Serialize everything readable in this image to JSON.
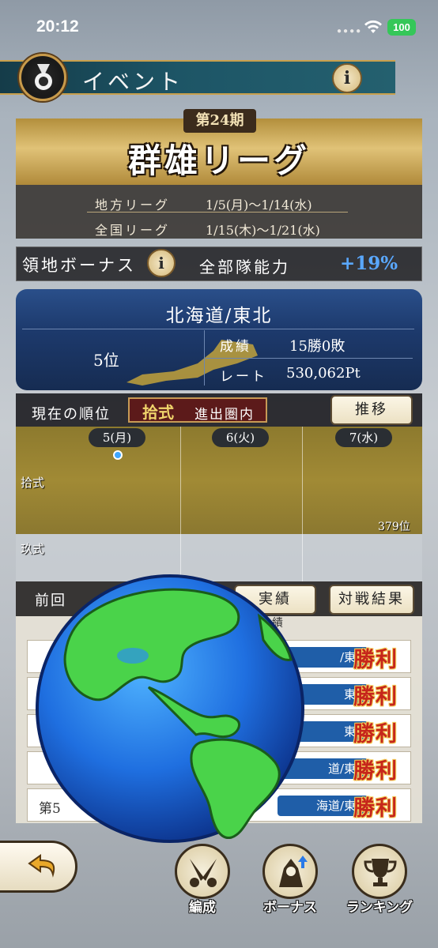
{
  "status": {
    "time": "20:12",
    "battery": "100"
  },
  "header": {
    "title": "イベント"
  },
  "season": {
    "tag": "第24期",
    "title": "群雄リーグ"
  },
  "schedule": [
    {
      "label": "地方リーグ",
      "dates": "1/5(月)〜1/14(水)"
    },
    {
      "label": "全国リーグ",
      "dates": "1/15(木)〜1/21(水)"
    }
  ],
  "bonus": {
    "label": "領地ボーナス",
    "name": "全部隊能力",
    "value": "+19%"
  },
  "region": {
    "name": "北海道/東北",
    "rank": "5位",
    "record_label": "成績",
    "record_value": "15勝0敗",
    "rate_label": "レート",
    "rate_value": "530,062Pt"
  },
  "standing": {
    "label": "現在の順位",
    "tier": "拾式",
    "note": "進出圏内",
    "history_button": "推移"
  },
  "chart_data": {
    "type": "line",
    "title": "",
    "categories": [
      "5(月)",
      "6(火)",
      "7(水)"
    ],
    "tiers": [
      "拾式",
      "玖式"
    ],
    "points": [
      {
        "x": "5(月)",
        "tier": "拾式"
      }
    ],
    "annotation": "379位"
  },
  "results": {
    "title": "前回",
    "partial_label": "績",
    "buttons": {
      "record": "実績",
      "battle": "対戦結果"
    },
    "rows": [
      {
        "round": "",
        "region": "/東北",
        "result": "勝利"
      },
      {
        "round": "",
        "region": "東北",
        "result": "勝利"
      },
      {
        "round": "",
        "region": "東北",
        "result": "勝利"
      },
      {
        "round": "",
        "region": "道/東北",
        "result": "勝利"
      },
      {
        "round": "第5",
        "region": "海道/東北",
        "result": "勝利"
      }
    ]
  },
  "nav": {
    "formation": "編成",
    "bonus": "ボーナス",
    "ranking": "ランキング"
  }
}
